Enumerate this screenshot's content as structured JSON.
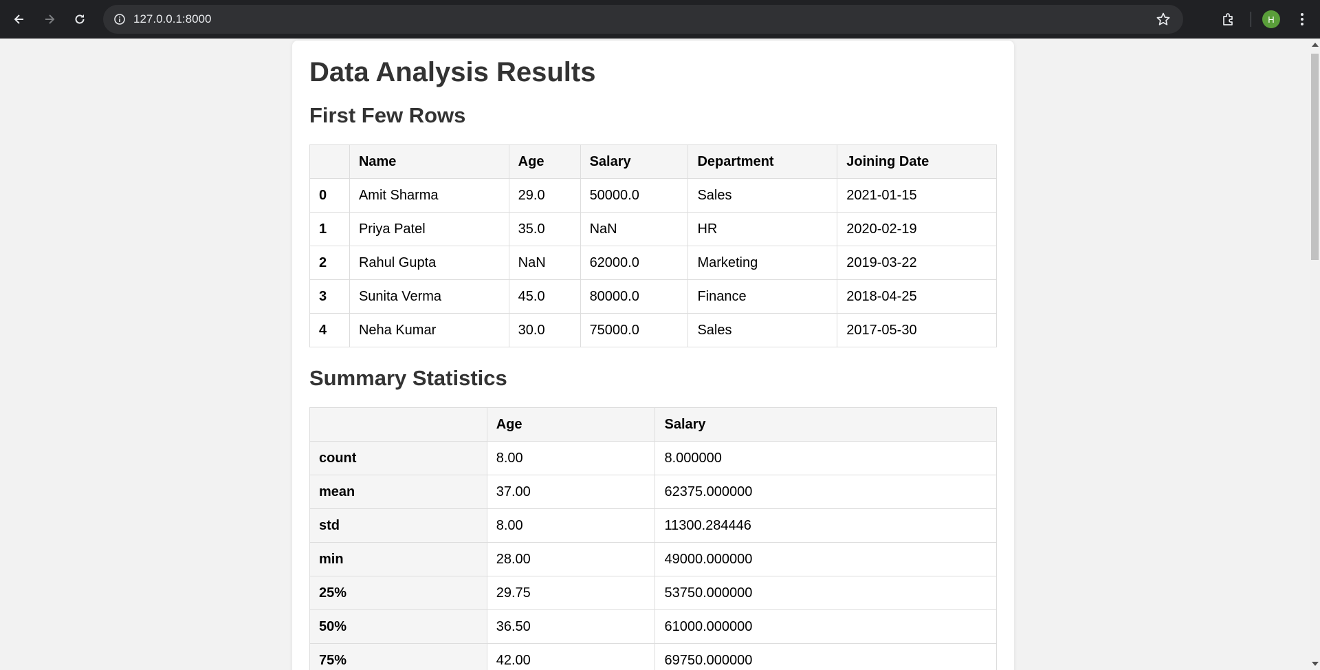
{
  "browser": {
    "url": "127.0.0.1:8000",
    "profile_initial": "H",
    "icons": [
      "back-icon",
      "forward-icon",
      "reload-icon",
      "info-icon",
      "star-icon",
      "extensions-icon",
      "menu-icon"
    ]
  },
  "page": {
    "title": "Data Analysis Results",
    "section1_title": "First Few Rows",
    "section2_title": "Summary Statistics"
  },
  "rows_table": {
    "headers": [
      "",
      "Name",
      "Age",
      "Salary",
      "Department",
      "Joining Date"
    ],
    "rows": [
      {
        "index": "0",
        "name": "Amit Sharma",
        "age": "29.0",
        "salary": "50000.0",
        "department": "Sales",
        "joining": "2021-01-15"
      },
      {
        "index": "1",
        "name": "Priya Patel",
        "age": "35.0",
        "salary": "NaN",
        "department": "HR",
        "joining": "2020-02-19"
      },
      {
        "index": "2",
        "name": "Rahul Gupta",
        "age": "NaN",
        "salary": "62000.0",
        "department": "Marketing",
        "joining": "2019-03-22"
      },
      {
        "index": "3",
        "name": "Sunita Verma",
        "age": "45.0",
        "salary": "80000.0",
        "department": "Finance",
        "joining": "2018-04-25"
      },
      {
        "index": "4",
        "name": "Neha Kumar",
        "age": "30.0",
        "salary": "75000.0",
        "department": "Sales",
        "joining": "2017-05-30"
      }
    ]
  },
  "stats_table": {
    "headers": [
      "",
      "Age",
      "Salary"
    ],
    "rows": [
      {
        "stat": "count",
        "age": "8.00",
        "salary": "8.000000"
      },
      {
        "stat": "mean",
        "age": "37.00",
        "salary": "62375.000000"
      },
      {
        "stat": "std",
        "age": "8.00",
        "salary": "11300.284446"
      },
      {
        "stat": "min",
        "age": "28.00",
        "salary": "49000.000000"
      },
      {
        "stat": "25%",
        "age": "29.75",
        "salary": "53750.000000"
      },
      {
        "stat": "50%",
        "age": "36.50",
        "salary": "61000.000000"
      },
      {
        "stat": "75%",
        "age": "42.00",
        "salary": "69750.000000"
      }
    ]
  },
  "colors": {
    "chrome_bar": "#202124",
    "omnibox": "#303134",
    "page_bg": "#f2f2f2",
    "avatar": "#5a9e3a"
  }
}
